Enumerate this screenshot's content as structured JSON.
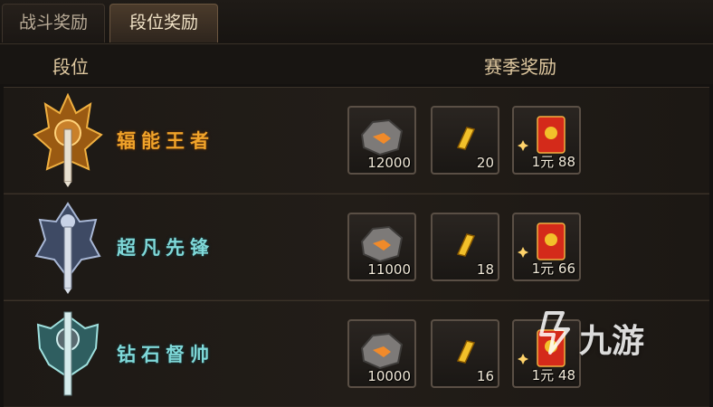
{
  "tabs": [
    {
      "label": "战斗奖励",
      "active": false
    },
    {
      "label": "段位奖励",
      "active": true
    }
  ],
  "headers": {
    "rank": "段位",
    "reward": "赛季奖励"
  },
  "rows": [
    {
      "name": "辐能王者",
      "color": "#f0a32a",
      "rewards": [
        {
          "icon": "ore-stone-icon",
          "qty": "12000"
        },
        {
          "icon": "gold-bar-icon",
          "qty": "20"
        },
        {
          "icon": "red-envelope-icon",
          "qty": "1元 88"
        }
      ]
    },
    {
      "name": "超凡先锋",
      "color": "#7fd8d8",
      "rewards": [
        {
          "icon": "ore-stone-icon",
          "qty": "11000"
        },
        {
          "icon": "gold-bar-icon",
          "qty": "18"
        },
        {
          "icon": "red-envelope-icon",
          "qty": "1元 66"
        }
      ]
    },
    {
      "name": "钻石督帅",
      "color": "#7fd8d8",
      "rewards": [
        {
          "icon": "ore-stone-icon",
          "qty": "10000"
        },
        {
          "icon": "gold-bar-icon",
          "qty": "16"
        },
        {
          "icon": "red-envelope-icon",
          "qty": "1元 48"
        }
      ]
    }
  ],
  "watermark": {
    "text": "九游"
  }
}
